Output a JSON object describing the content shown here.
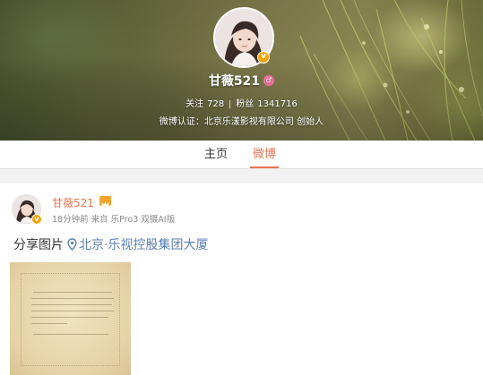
{
  "profile": {
    "nickname": "甘薇521",
    "follow_label": "关注",
    "follow_count": "728",
    "fans_label": "粉丝",
    "fans_count": "1341716",
    "verification": "微博认证：北京乐漾影视有限公司 创始人"
  },
  "tabs": [
    {
      "label": "主页",
      "active": false
    },
    {
      "label": "微博",
      "active": true
    }
  ],
  "post": {
    "author": "甘薇521",
    "time": "18分钟前",
    "source": "来自 乐Pro3 双摄AI版",
    "text": "分享图片",
    "location": "北京·乐视控股集团大厦",
    "image_alt_icon": "image-thumbnail"
  },
  "colors": {
    "accent": "#eb7350",
    "link": "#5b7fb5",
    "vip_badge": "#f7a40a",
    "pink_badge": "#f26fa0"
  }
}
